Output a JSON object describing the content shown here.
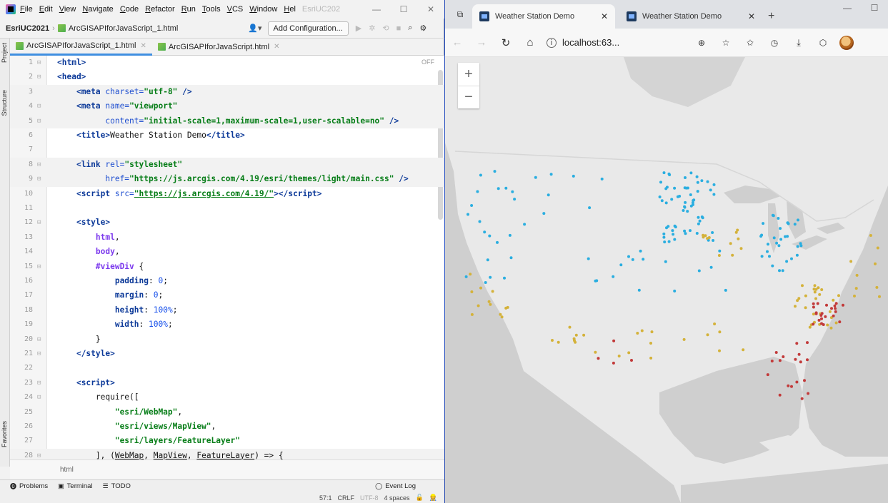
{
  "ide": {
    "menu": [
      "File",
      "Edit",
      "View",
      "Navigate",
      "Code",
      "Refactor",
      "Run",
      "Tools",
      "VCS",
      "Window",
      "Hel"
    ],
    "title_fragment": "EsriUC202",
    "project": "EsriUC2021",
    "crumb_file": "ArcGISAPIforJavaScript_1.html",
    "add_config": "Add Configuration...",
    "tabs": [
      "ArcGISAPIforJavaScript_1.html",
      "ArcGISAPIforJavaScript.html"
    ],
    "side_labels": [
      "Project",
      "Structure",
      "Favorites"
    ],
    "off_label": "OFF",
    "breadcrumb": "html",
    "tool_windows": [
      "Problems",
      "Terminal",
      "TODO"
    ],
    "event_log": "Event Log",
    "status": [
      "57:1",
      "CRLF",
      "UTF-8",
      "4 spaces"
    ],
    "line_numbers": [
      "1",
      "2",
      "3",
      "4",
      "5",
      "6",
      "7",
      "8",
      "9",
      "10",
      "11",
      "12",
      "13",
      "14",
      "15",
      "16",
      "17",
      "18",
      "19",
      "20",
      "21",
      "22",
      "23",
      "24",
      "25",
      "26",
      "27",
      "28"
    ]
  },
  "browser": {
    "tabs": [
      "Weather Station Demo",
      "Weather Station Demo"
    ],
    "address": "localhost:63...",
    "zoom_in": "+",
    "zoom_out": "−"
  },
  "colors": {
    "blue_station": "#2aaee0",
    "yellow_station": "#d4b23a",
    "red_station": "#c23a3a",
    "land": "#e8e8e8",
    "water": "#d0d0d0"
  }
}
